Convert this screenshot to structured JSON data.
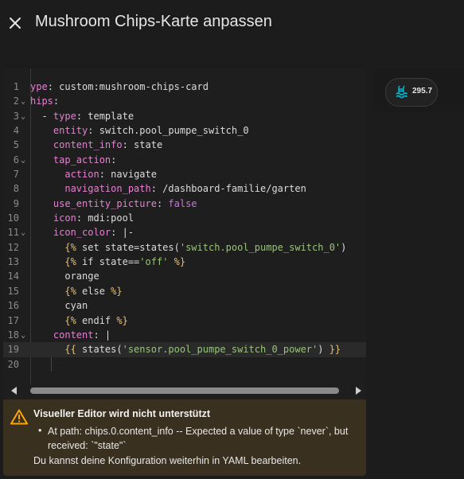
{
  "header": {
    "close_icon": "close-icon",
    "title": "Mushroom Chips-Karte anpassen"
  },
  "editor": {
    "lines": [
      {
        "num": "1",
        "fold": false,
        "segments": [
          [
            "k",
            "ype"
          ],
          [
            "p",
            ": custom:mushroom-chips-card"
          ]
        ]
      },
      {
        "num": "2",
        "fold": true,
        "segments": [
          [
            "k",
            "hips"
          ],
          [
            "p",
            ":"
          ]
        ]
      },
      {
        "num": "3",
        "fold": true,
        "segments": [
          [
            "p",
            "  - "
          ],
          [
            "k",
            "type"
          ],
          [
            "p",
            ": template"
          ]
        ]
      },
      {
        "num": "4",
        "fold": false,
        "segments": [
          [
            "p",
            "    "
          ],
          [
            "k",
            "entity"
          ],
          [
            "p",
            ": switch.pool_pumpe_switch_0"
          ]
        ]
      },
      {
        "num": "5",
        "fold": false,
        "segments": [
          [
            "p",
            "    "
          ],
          [
            "k",
            "content_info"
          ],
          [
            "p",
            ": state"
          ]
        ]
      },
      {
        "num": "6",
        "fold": true,
        "segments": [
          [
            "p",
            "    "
          ],
          [
            "k",
            "tap_action"
          ],
          [
            "p",
            ":"
          ]
        ]
      },
      {
        "num": "7",
        "fold": false,
        "segments": [
          [
            "p",
            "      "
          ],
          [
            "k",
            "action"
          ],
          [
            "p",
            ": navigate"
          ]
        ]
      },
      {
        "num": "8",
        "fold": false,
        "segments": [
          [
            "p",
            "      "
          ],
          [
            "k",
            "navigation_path"
          ],
          [
            "p",
            ": /dashboard-familie/garten"
          ]
        ]
      },
      {
        "num": "9",
        "fold": false,
        "segments": [
          [
            "p",
            "    "
          ],
          [
            "k",
            "use_entity_picture"
          ],
          [
            "p",
            ": "
          ],
          [
            "b",
            "false"
          ]
        ]
      },
      {
        "num": "10",
        "fold": false,
        "segments": [
          [
            "p",
            "    "
          ],
          [
            "k",
            "icon"
          ],
          [
            "p",
            ": mdi:pool"
          ]
        ]
      },
      {
        "num": "11",
        "fold": true,
        "segments": [
          [
            "p",
            "    "
          ],
          [
            "k",
            "icon_color"
          ],
          [
            "p",
            ": |-"
          ]
        ]
      },
      {
        "num": "12",
        "fold": false,
        "segments": [
          [
            "p",
            "      "
          ],
          [
            "br",
            "{%"
          ],
          [
            "p",
            " set state=states("
          ],
          [
            "s",
            "'switch.pool_pumpe_switch_0'"
          ],
          [
            "p",
            ") "
          ]
        ]
      },
      {
        "num": "13",
        "fold": false,
        "segments": [
          [
            "p",
            "      "
          ],
          [
            "br",
            "{%"
          ],
          [
            "p",
            " if state=="
          ],
          [
            "s",
            "'off'"
          ],
          [
            "p",
            " "
          ],
          [
            "br",
            "%}"
          ]
        ]
      },
      {
        "num": "14",
        "fold": false,
        "segments": [
          [
            "p",
            "      orange"
          ]
        ]
      },
      {
        "num": "15",
        "fold": false,
        "segments": [
          [
            "p",
            "      "
          ],
          [
            "br",
            "{%"
          ],
          [
            "p",
            " else "
          ],
          [
            "br",
            "%}"
          ]
        ]
      },
      {
        "num": "16",
        "fold": false,
        "segments": [
          [
            "p",
            "      cyan"
          ]
        ]
      },
      {
        "num": "17",
        "fold": false,
        "segments": [
          [
            "p",
            "      "
          ],
          [
            "br",
            "{%"
          ],
          [
            "p",
            " endif "
          ],
          [
            "br",
            "%}"
          ]
        ]
      },
      {
        "num": "18",
        "fold": true,
        "segments": [
          [
            "p",
            "    "
          ],
          [
            "k",
            "content"
          ],
          [
            "p",
            ": |"
          ]
        ]
      },
      {
        "num": "19",
        "fold": false,
        "active": true,
        "segments": [
          [
            "p",
            "      "
          ],
          [
            "br",
            "{{"
          ],
          [
            "p",
            " states("
          ],
          [
            "s",
            "'sensor.pool_pumpe_switch_0_power'"
          ],
          [
            "p",
            ") "
          ],
          [
            "br",
            "}}"
          ]
        ]
      },
      {
        "num": "20",
        "fold": false,
        "segments": []
      }
    ]
  },
  "preview": {
    "chip_icon": "pool-icon",
    "chip_value": "295.7",
    "chip_color": "#00bcd4"
  },
  "warning": {
    "icon": "warning-icon",
    "title": "Visueller Editor wird nicht unterstützt",
    "bullet": "•",
    "message": "At path: chips.0.content_info -- Expected a value of type `never`, but received: `\"state\"`",
    "footer": "Du kannst deine Konfiguration weiterhin in YAML bearbeiten.",
    "color": "#ffa600"
  }
}
